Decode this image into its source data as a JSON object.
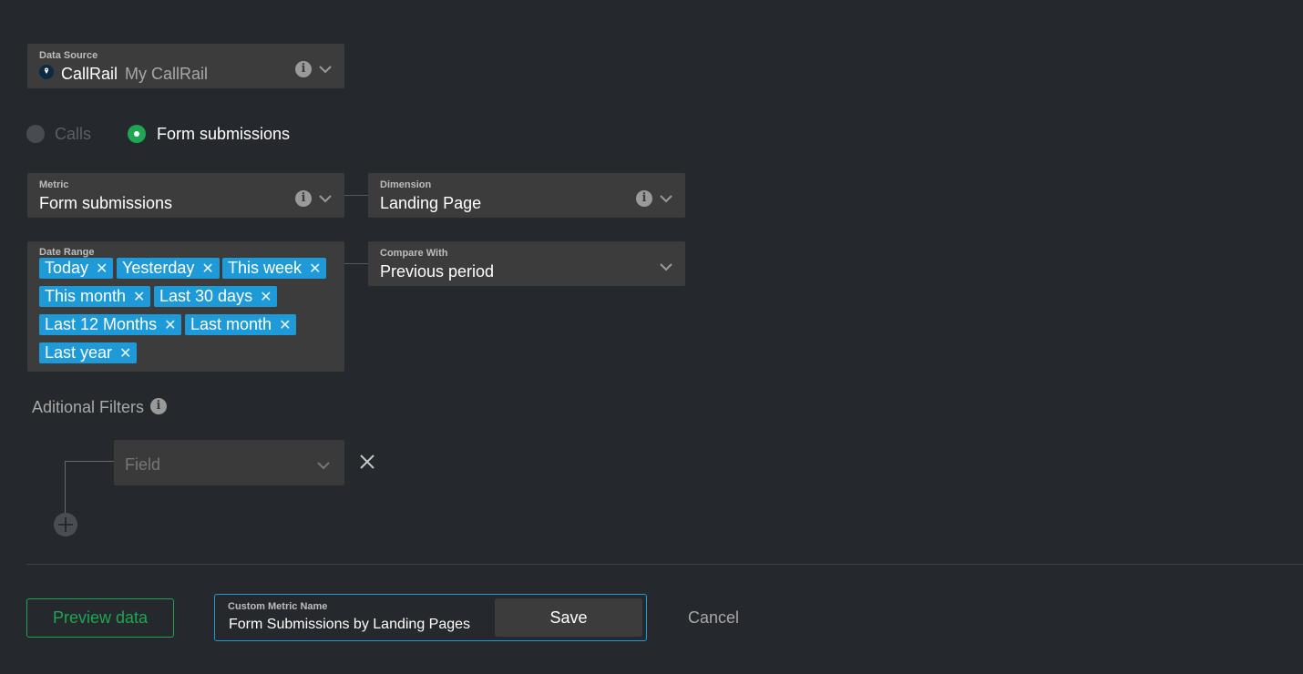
{
  "data_source": {
    "label": "Data Source",
    "name": "CallRail",
    "account": "My CallRail"
  },
  "types": [
    {
      "label": "Calls",
      "selected": false
    },
    {
      "label": "Form submissions",
      "selected": true
    }
  ],
  "metric": {
    "label": "Metric",
    "value": "Form submissions"
  },
  "dimension": {
    "label": "Dimension",
    "value": "Landing Page"
  },
  "date_range": {
    "label": "Date Range",
    "tags": [
      "Today",
      "Yesterday",
      "This week",
      "This month",
      "Last 30 days",
      "Last 12 Months",
      "Last month",
      "Last year"
    ],
    "remove_glyph": "✕"
  },
  "compare_with": {
    "label": "Compare With",
    "value": "Previous period"
  },
  "filters": {
    "title": "Aditional Filters",
    "field_placeholder": "Field"
  },
  "footer": {
    "preview_label": "Preview data",
    "custom_metric_label": "Custom Metric Name",
    "custom_metric_value": "Form Submissions by Landing Pages",
    "save_label": "Save",
    "cancel_label": "Cancel"
  },
  "colors": {
    "background": "#25282c",
    "field_bg": "#3c3c3c",
    "accent_green": "#1fa652",
    "tag_blue": "#1f9ad8",
    "input_border": "#1f9ad8"
  },
  "icons": {
    "info": "info-icon",
    "chevron": "chevron-down-icon",
    "remove": "close-icon",
    "add": "plus-icon",
    "source_logo": "callrail-logo-icon"
  }
}
